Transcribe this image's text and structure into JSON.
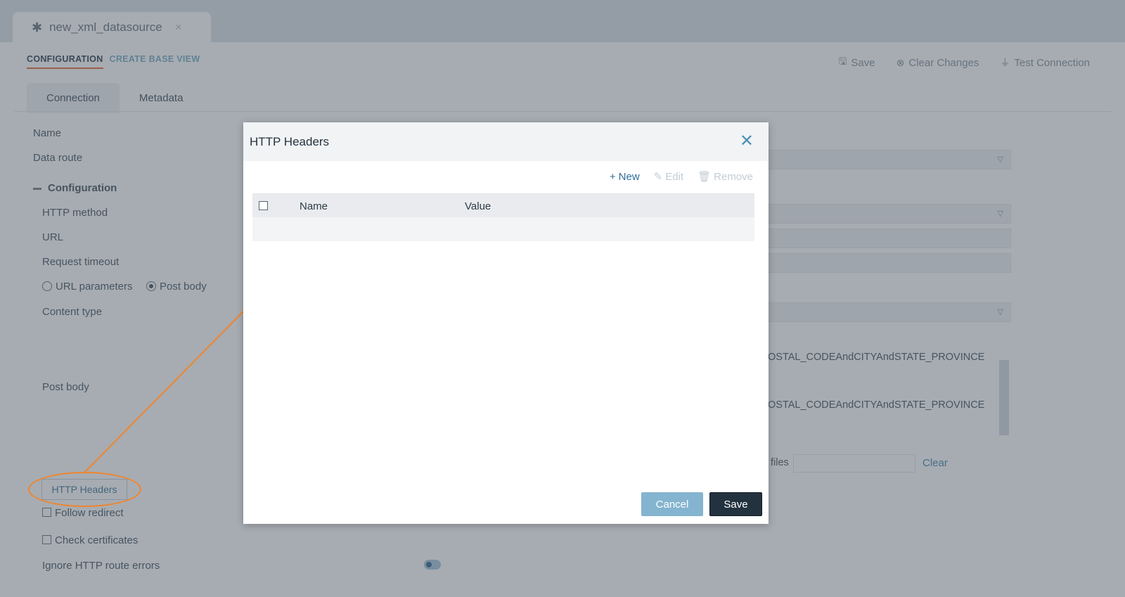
{
  "file_tab": {
    "icon": "asterisk-icon",
    "title": "new_xml_datasource",
    "close": "×"
  },
  "subtabs": {
    "configuration": "CONFIGURATION",
    "create_base_view": "CREATE BASE VIEW"
  },
  "toolbar": {
    "save": "Save",
    "clear_changes": "Clear Changes",
    "test_connection": "Test Connection"
  },
  "conn_tabs": {
    "connection": "Connection",
    "metadata": "Metadata"
  },
  "form": {
    "name": "Name",
    "data_route": "Data route",
    "configuration": "Configuration",
    "http_method": "HTTP method",
    "url": "URL",
    "request_timeout": "Request timeout",
    "url_parameters": "URL parameters",
    "post_body_option": "Post body",
    "content_type": "Content type",
    "post_body": "Post body",
    "http_headers_button": "HTTP Headers",
    "follow_redirect": "Follow redirect",
    "check_certificates": "Check certificates",
    "ignore_http_route_errors": "Ignore HTTP route errors",
    "post_body_line1": "OSTAL_CODEAndCITYAndSTATE_PROVINCE",
    "post_body_line2": "OSTAL_CODEAndCITYAndSTATE_PROVINCE",
    "files_label": "files",
    "clear_link": "Clear"
  },
  "dialog": {
    "title": "HTTP Headers",
    "close_icon": "close-icon",
    "tools": {
      "new": "New",
      "edit": "Edit",
      "remove": "Remove"
    },
    "columns": [
      "Name",
      "Value"
    ],
    "cancel": "Cancel",
    "save": "Save"
  },
  "colors": {
    "accent": "#e8734a",
    "callout": "#f0852d",
    "primary_dark": "#23323f",
    "cancel_blue": "#84b4cf"
  }
}
